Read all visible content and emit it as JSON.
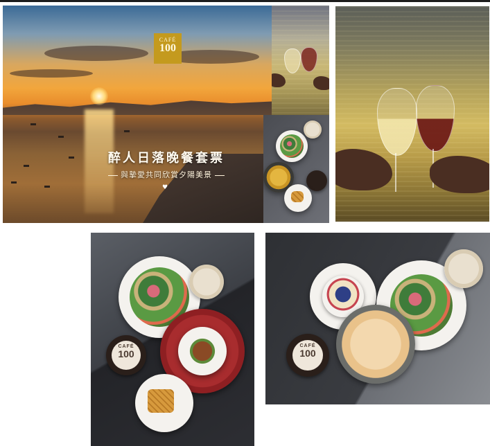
{
  "banner": {
    "logo_line1": "CAFÉ",
    "logo_line2": "100",
    "headline": "醉人日落晚餐套票",
    "subline": "與摯愛共同欣賞夕陽美景",
    "heart": "♥"
  },
  "cup_logo": {
    "line1": "CAFÉ",
    "line2": "100"
  },
  "colors": {
    "logo_gold": "#c49a1e",
    "plate_red": "#a82c2e"
  }
}
